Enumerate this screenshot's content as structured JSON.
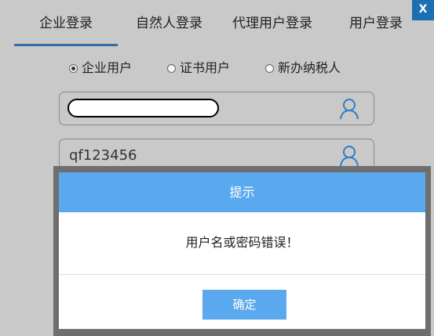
{
  "window": {
    "close_label": "X"
  },
  "tabs": [
    {
      "label": "企业登录",
      "active": true
    },
    {
      "label": "自然人登录",
      "active": false
    },
    {
      "label": "代理用户登录",
      "active": false
    },
    {
      "label": "用户登录",
      "active": false
    }
  ],
  "user_types": [
    {
      "label": "企业用户",
      "selected": true
    },
    {
      "label": "证书用户",
      "selected": false
    },
    {
      "label": "新办纳税人",
      "selected": false
    }
  ],
  "fields": {
    "username_value": "",
    "password_value": "qf123456",
    "icon": "user-icon"
  },
  "dialog": {
    "title": "提示",
    "message": "用户名或密码错误！",
    "ok_label": "确定"
  },
  "colors": {
    "accent": "#5aa8ee",
    "close_button": "#1d6fb3",
    "tab_underline": "#2f6ea6"
  }
}
